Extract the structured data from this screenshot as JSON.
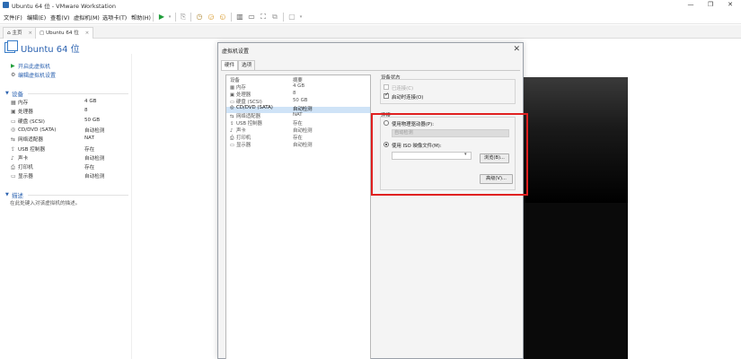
{
  "window": {
    "title": "Ubuntu 64 位 - VMware Workstation",
    "controls": [
      "—",
      "❐",
      "✕"
    ]
  },
  "menu": [
    "文件(F)",
    "编辑(E)",
    "查看(V)",
    "虚拟机(M)",
    "选项卡(T)",
    "帮助(H)"
  ],
  "tabs": [
    {
      "label": "主页"
    },
    {
      "label": "Ubuntu 64 位"
    }
  ],
  "vm": {
    "title": "Ubuntu 64 位",
    "actions": [
      "开启此虚拟机",
      "编辑虚拟机设置"
    ],
    "devices_section": "设备",
    "devices": [
      {
        "name": "内存",
        "value": "4 GB",
        "icon": "memory-icon"
      },
      {
        "name": "处理器",
        "value": "8",
        "icon": "cpu-icon"
      },
      {
        "name": "硬盘 (SCSI)",
        "value": "50 GB",
        "icon": "disk-icon"
      },
      {
        "name": "CD/DVD (SATA)",
        "value": "自动检测",
        "icon": "cd-icon"
      },
      {
        "name": "网络适配器",
        "value": "NAT",
        "icon": "network-icon"
      },
      {
        "name": "USB 控制器",
        "value": "存在",
        "icon": "usb-icon"
      },
      {
        "name": "声卡",
        "value": "自动检测",
        "icon": "sound-icon"
      },
      {
        "name": "打印机",
        "value": "存在",
        "icon": "printer-icon"
      },
      {
        "name": "显示器",
        "value": "自动检测",
        "icon": "display-icon"
      }
    ],
    "description_section": "描述",
    "description_placeholder": "在此处键入对该虚拟机的描述。"
  },
  "dialog": {
    "title": "虚拟机设置",
    "tabs": [
      "硬件",
      "选项"
    ],
    "list_headers": [
      "设备",
      "摘要"
    ],
    "list": [
      {
        "name": "内存",
        "summary": "4 GB"
      },
      {
        "name": "处理器",
        "summary": "8"
      },
      {
        "name": "硬盘 (SCSI)",
        "summary": "50 GB"
      },
      {
        "name": "CD/DVD (SATA)",
        "summary": "自动检测",
        "selected": true
      },
      {
        "name": "网络适配器",
        "summary": "NAT"
      },
      {
        "name": "USB 控制器",
        "summary": "存在"
      },
      {
        "name": "声卡",
        "summary": "自动检测"
      },
      {
        "name": "打印机",
        "summary": "存在"
      },
      {
        "name": "显示器",
        "summary": "自动检测"
      }
    ],
    "device_status": {
      "label": "设备状态",
      "connected": "已连接(C)",
      "connect_at_power_on": "启动时连接(O)"
    },
    "connection": {
      "label": "连接",
      "use_physical": "使用物理驱动器(P):",
      "physical_value": "自动检测",
      "use_iso": "使用 ISO 映像文件(M):",
      "iso_value": "",
      "browse_button": "浏览(B)...",
      "advanced_button": "高级(V)..."
    },
    "highlight_color": "#e02020"
  }
}
